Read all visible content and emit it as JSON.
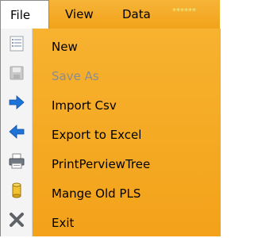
{
  "menubar": {
    "file_label": "File",
    "view_label": "View",
    "data_label": "Data",
    "stars": "******"
  },
  "file_menu": {
    "items": [
      {
        "label": "New",
        "icon": "new-document-icon",
        "enabled": true
      },
      {
        "label": "Save As",
        "icon": "save-disk-icon",
        "enabled": false
      },
      {
        "label": "Import Csv",
        "icon": "arrow-right-icon",
        "enabled": true
      },
      {
        "label": "Export to Excel",
        "icon": "arrow-left-icon",
        "enabled": true
      },
      {
        "label": "PrintPerviewTree",
        "icon": "printer-icon",
        "enabled": true
      },
      {
        "label": "Mange Old PLS",
        "icon": "database-cylinder-icon",
        "enabled": true
      },
      {
        "label": "Exit",
        "icon": "close-x-icon",
        "enabled": true
      }
    ]
  },
  "colors": {
    "menu_background": "#f3a418",
    "icon_strip": "#f4f4f4",
    "disabled_text": "#8c8c8c",
    "arrow_blue": "#1e73d8"
  }
}
